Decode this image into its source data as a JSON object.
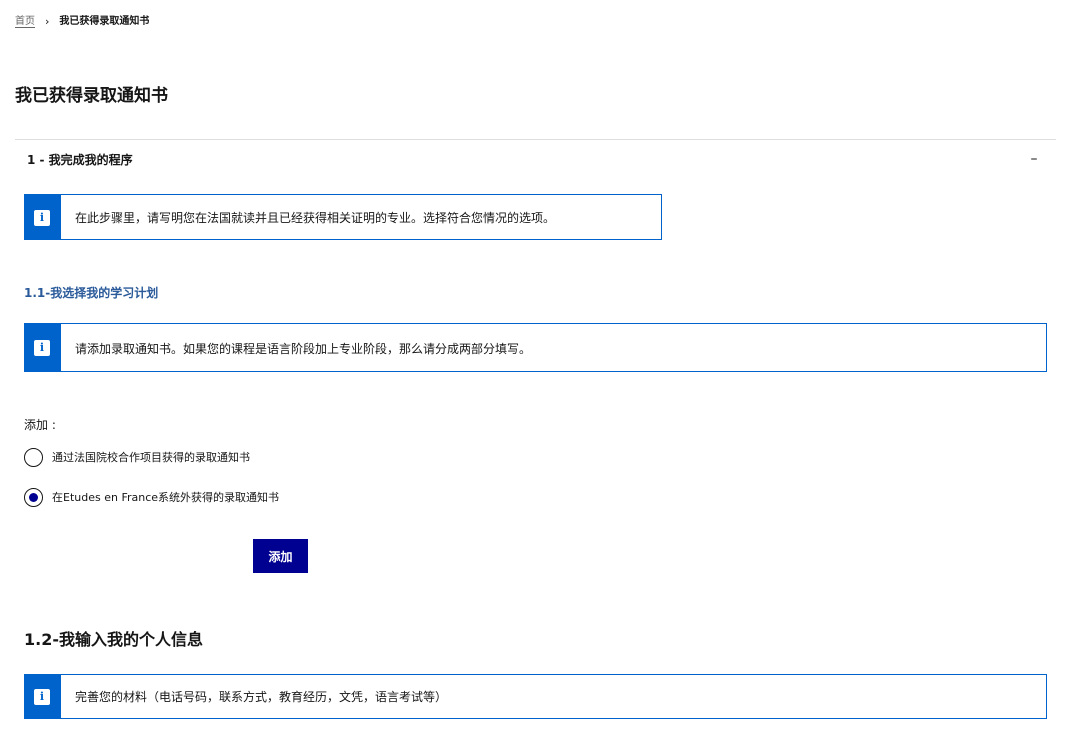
{
  "breadcrumb": {
    "home": "首页",
    "separator": "›",
    "current": "我已获得录取通知书"
  },
  "page": {
    "title": "我已获得录取通知书"
  },
  "accordion": {
    "title": "1 - 我完成我的程序",
    "toggle_icon": "–",
    "expanded": true
  },
  "notices": {
    "step": "在此步骤里，请写明您在法国就读并且已经获得相关证明的专业。选择符合您情况的选项。",
    "admission": "请添加录取通知书。如果您的课程是语言阶段加上专业阶段，那么请分成两部分填写。",
    "personal": "完善您的材料（电话号码，联系方式，教育经历，文凭，语言考试等）",
    "icon_glyph": "i",
    "icon": "info-icon"
  },
  "section_1_1": {
    "title": "1.1-我选择我的学习计划"
  },
  "add_form": {
    "label": "添加 :",
    "options": [
      {
        "label": "通过法国院校合作项目获得的录取通知书",
        "selected": false
      },
      {
        "label": "在Etudes en France系统外获得的录取通知书",
        "selected": true
      }
    ],
    "button_label": "添加"
  },
  "section_1_2": {
    "title": "1.2-我输入我的个人信息"
  },
  "colors": {
    "primary_blue": "#000091",
    "info_blue": "#0063cb",
    "subtitle_blue": "#2a5a9a",
    "text": "#161616",
    "divider": "#dddddd"
  }
}
